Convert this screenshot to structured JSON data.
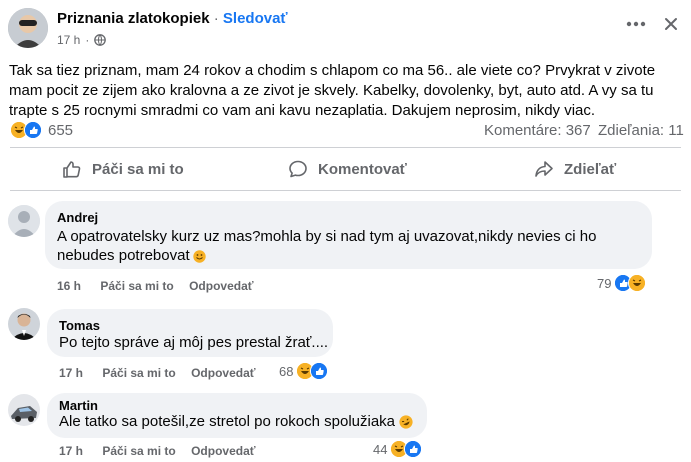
{
  "post": {
    "page_name": "Priznania zlatokopiek",
    "separator": "·",
    "follow_label": "Sledovať",
    "time": "17 h",
    "dot": "·",
    "text": "Tak sa tiez priznam, mam 24 rokov a chodim s chlapom co ma 56.. ale viete co? Prvykrat v zivote mam pocit ze zijem ako kralovna a ze zivot je skvely. Kabelky, dovolenky, byt, auto atd. A vy sa tu trapte s 25 rocnymi smradmi co vam ani kavu nezaplatia. Dakujem neprosim, nikdy viac.",
    "reaction_count": "655",
    "comments_count": "Komentáre: 367",
    "shares_count": "Zdieľania: 11",
    "icons": [
      "globe-icon",
      "more-icon",
      "close-icon",
      "haha-reaction-icon",
      "like-reaction-icon"
    ]
  },
  "actions": {
    "like": "Páči sa mi to",
    "comment": "Komentovať",
    "share": "Zdieľať"
  },
  "comments": [
    {
      "author": "Andrej",
      "text_line1": "A opatrovatelsky kurz uz mas?mohla by si nad tym aj uvazovat,nikdy nevies ci ho",
      "text_line2": "nebudes potrebovat",
      "time": "16 h",
      "like": "Páči sa mi to",
      "reply": "Odpovedať",
      "reactions": "79"
    },
    {
      "author": "Tomas",
      "text": "Po tejto správe aj môj pes prestal žrať....",
      "time": "17 h",
      "like": "Páči sa mi to",
      "reply": "Odpovedať",
      "reactions": "68"
    },
    {
      "author": "Martin",
      "text": "Ale tatko sa potešil,ze stretol po rokoch spolužiaka",
      "time": "17 h",
      "like": "Páči sa mi to",
      "reply": "Odpovedať",
      "reactions": "44"
    }
  ],
  "colors": {
    "accent": "#1877f2",
    "muted": "#65676b",
    "bubble": "#f0f2f5",
    "haha": "#f7b125"
  }
}
